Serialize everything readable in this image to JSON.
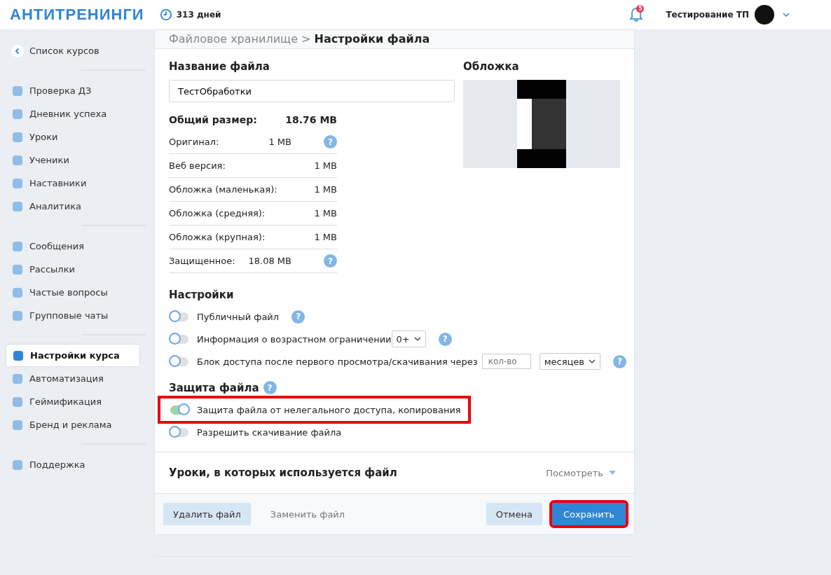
{
  "header": {
    "logo": "АНТИТРЕНИНГИ",
    "days": "313 дней",
    "notifications": "5",
    "user": "Тестирование ТП"
  },
  "sidebar": {
    "groups": [
      [
        {
          "label": "Список курсов",
          "selected": false
        }
      ],
      [
        {
          "label": "Проверка ДЗ",
          "selected": false
        },
        {
          "label": "Дневник успеха",
          "selected": false
        },
        {
          "label": "Уроки",
          "selected": false
        },
        {
          "label": "Ученики",
          "selected": false
        },
        {
          "label": "Наставники",
          "selected": false
        },
        {
          "label": "Аналитика",
          "selected": false
        }
      ],
      [
        {
          "label": "Сообщения",
          "selected": false
        },
        {
          "label": "Рассылки",
          "selected": false
        },
        {
          "label": "Частые вопросы",
          "selected": false
        },
        {
          "label": "Групповые чаты",
          "selected": false
        }
      ],
      [
        {
          "label": "Настройки курса",
          "selected": true
        },
        {
          "label": "Автоматизация",
          "selected": false
        },
        {
          "label": "Геймификация",
          "selected": false
        },
        {
          "label": "Бренд и реклама",
          "selected": false
        }
      ],
      [
        {
          "label": "Поддержка",
          "selected": false
        }
      ]
    ]
  },
  "breadcrumb": {
    "parent": "Файловое хранилище",
    "separator": ">",
    "current": "Настройки файла"
  },
  "file_name": {
    "label": "Название файла",
    "value": "ТестОбработки"
  },
  "cover": {
    "label": "Обложка"
  },
  "total": {
    "label": "Общий размер:",
    "value": "18.76 MB"
  },
  "sizes": [
    {
      "label": "Оригинал:",
      "value": "1 MB",
      "help": "?"
    },
    {
      "label": "Веб версия:",
      "value": "1 MB"
    },
    {
      "label": "Обложка (маленькая):",
      "value": "1 MB"
    },
    {
      "label": "Обложка (средняя):",
      "value": "1 MB"
    },
    {
      "label": "Обложка (крупная):",
      "value": "1 MB"
    },
    {
      "label": "Защищенное:",
      "value": "18.08 MB",
      "help": "?"
    }
  ],
  "settings": {
    "title": "Настройки",
    "rows": [
      {
        "kind": "plain",
        "label": "Публичный файл",
        "on": false,
        "help": "?"
      },
      {
        "kind": "age",
        "label": "Информация о возрастном ограничении",
        "on": false,
        "help": "?",
        "select": "0+"
      },
      {
        "kind": "block",
        "label": "Блок доступа после первого просмотра/скачивания через",
        "on": false,
        "help": "?",
        "placeholder": "кол-во",
        "select": "месяцев"
      }
    ]
  },
  "protection": {
    "title": "Защита файла",
    "help": "?",
    "rows": [
      {
        "label": "Защита файла от нелегального доступа, копирования",
        "on": true,
        "highlighted": true
      },
      {
        "label": "Разрешить скачивание файла",
        "on": false,
        "highlighted": false
      }
    ]
  },
  "lessons": {
    "title": "Уроки, в которых используется файл",
    "link": "Посмотреть"
  },
  "buttons": {
    "delete": "Удалить файл",
    "replace": "Заменить файл",
    "cancel": "Отмена",
    "save": "Сохранить",
    "save_highlighted": true
  }
}
